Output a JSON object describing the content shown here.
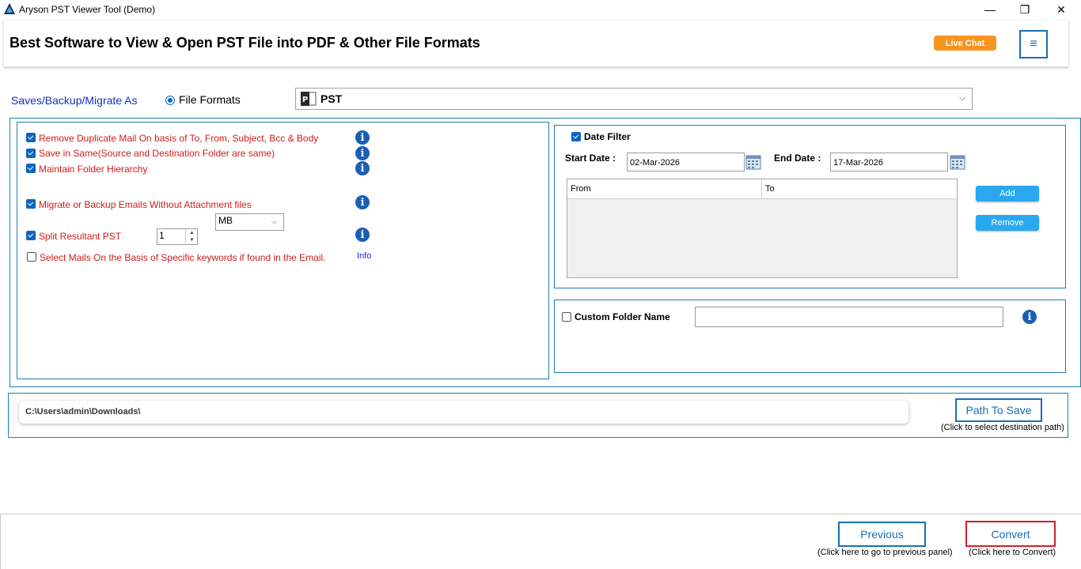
{
  "window": {
    "title": "Aryson PST Viewer Tool (Demo)",
    "minimize": "—",
    "maximize": "❐",
    "close": "✕"
  },
  "header": {
    "title": "Best Software to View & Open PST File into PDF & Other File Formats",
    "live_chat": "Live Chat",
    "menu_icon": "≡"
  },
  "save_as": {
    "label": "Saves/Backup/Migrate As",
    "radio_label": "File Formats",
    "format_value": "PST",
    "format_icon_letter": "P"
  },
  "options": {
    "items": [
      {
        "label": "Remove Duplicate Mail On basis of To, From, Subject, Bcc & Body",
        "checked": true
      },
      {
        "label": "Save in Same(Source and Destination Folder are same)",
        "checked": true
      },
      {
        "label": "Maintain Folder Hierarchy",
        "checked": true
      },
      {
        "label": "Migrate or Backup Emails Without Attachment files",
        "checked": true
      },
      {
        "label": "Split Resultant PST",
        "checked": true
      },
      {
        "label": "Select Mails On the Basis of Specific keywords if found in the Email.",
        "checked": false
      }
    ],
    "info_glyph": "i",
    "info_link": "Info",
    "split_size": "1",
    "split_unit": "MB",
    "spin_up": "▲",
    "spin_down": "▼"
  },
  "date_filter": {
    "label": "Date Filter",
    "checked": true,
    "start_label": "Start Date :",
    "start_value": "02-Mar-2026",
    "end_label": "End Date :",
    "end_value": "17-Mar-2026",
    "col_from": "From",
    "col_to": "To",
    "add_button": "Add",
    "remove_button": "Remove"
  },
  "custom_folder": {
    "label": "Custom Folder Name",
    "checked": false,
    "value": ""
  },
  "destination": {
    "path": "C:\\Users\\admin\\Downloads\\",
    "button": "Path To Save",
    "hint": "(Click to select destination path)"
  },
  "footer": {
    "previous": "Previous",
    "previous_hint": "(Click here to go to previous panel)",
    "convert": "Convert",
    "convert_hint": "(Click here to Convert)"
  },
  "colors": {
    "accent": "#1a6fb3",
    "live_chat": "#f7931e",
    "option_text": "#d11a1a",
    "convert_border": "#d0202a",
    "blue_button": "#29a8f0"
  }
}
